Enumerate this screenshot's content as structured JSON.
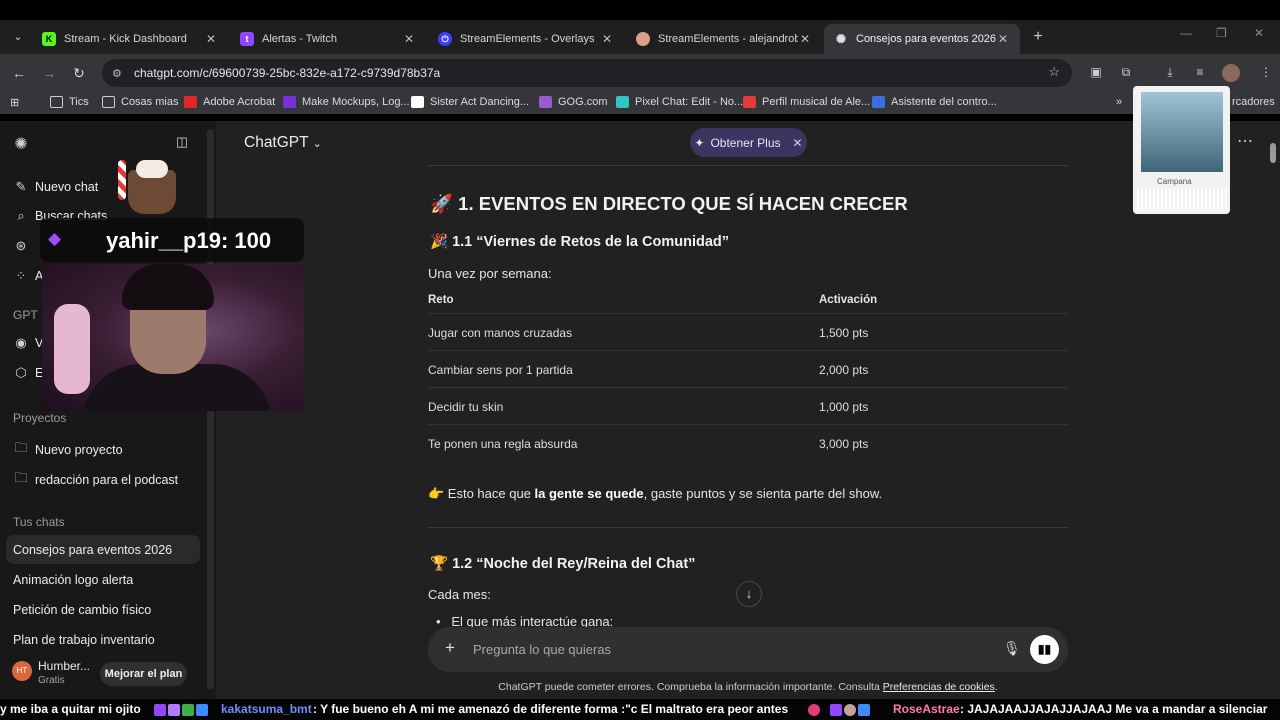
{
  "browser": {
    "tabs": [
      {
        "title": "Stream - Kick Dashboard",
        "favicon": "kick-icon",
        "color": "#53fc18",
        "active": false
      },
      {
        "title": "Alertas - Twitch",
        "favicon": "twitch-icon",
        "color": "#9146ff",
        "active": false
      },
      {
        "title": "StreamElements - Overlays",
        "favicon": "streamelements-icon",
        "color": "#3d3dff",
        "active": false
      },
      {
        "title": "StreamElements - alejandrobmt",
        "favicon": "streamelements-icon",
        "color": "#d9a087",
        "active": false
      },
      {
        "title": "Consejos para eventos 2026",
        "favicon": "openai-icon",
        "color": "#e0e0e0",
        "active": true
      }
    ],
    "url": "chatgpt.com/c/69600739-25bc-832e-a172-c9739d78b37a",
    "bookmarks": [
      {
        "label": "Tics",
        "icon": "folder-icon"
      },
      {
        "label": "Cosas mias",
        "icon": "folder-icon"
      },
      {
        "label": "Adobe Acrobat",
        "icon": "acrobat-icon",
        "color": "#e5252a"
      },
      {
        "label": "Make Mockups, Log...",
        "icon": "placeit-icon",
        "color": "#7b2fd6"
      },
      {
        "label": "Sister Act Dancing...",
        "icon": "doc-icon",
        "color": "#ffffff"
      },
      {
        "label": "GOG.com",
        "icon": "gog-icon",
        "color": "#9a5ad0"
      },
      {
        "label": "Pixel Chat: Edit - No...",
        "icon": "pixelchat-icon",
        "color": "#31c6c6"
      },
      {
        "label": "Perfil musical de Ale...",
        "icon": "music-profile-icon",
        "color": "#e23c3c"
      },
      {
        "label": "Asistente del contro...",
        "icon": "assistant-icon",
        "color": "#3a6de0"
      }
    ],
    "bookmarks_more": "rcadores"
  },
  "sidebar": {
    "primary": [
      {
        "label": "Nuevo chat",
        "icon": "new-chat-icon"
      },
      {
        "label": "Buscar chats",
        "icon": "search-icon"
      },
      {
        "label": "",
        "icon": "images-icon"
      },
      {
        "label": "A",
        "icon": "apps-icon"
      }
    ],
    "gpt_heading": "GPT",
    "gpts": [
      {
        "label": "V",
        "icon": "gpt-icon"
      },
      {
        "label": "E",
        "icon": "cube-icon"
      }
    ],
    "projects_heading": "Proyectos",
    "projects": [
      {
        "label": "Nuevo proyecto",
        "icon": "folder-plus-icon"
      },
      {
        "label": "redacción para el podcast",
        "icon": "folder-icon"
      }
    ],
    "chats_heading": "Tus chats",
    "chats": [
      "Consejos para eventos 2026",
      "Animación logo alerta",
      "Petición de cambio físico",
      "Plan de trabajo inventario"
    ],
    "user": {
      "initials": "HT",
      "name": "Humber...",
      "plan": "Gratis",
      "upgrade": "Mejorar el plan"
    }
  },
  "header": {
    "title": "ChatGPT",
    "plus_label": "Obtener Plus"
  },
  "content": {
    "h1": "🚀 1. EVENTOS EN DIRECTO QUE SÍ HACEN CRECER",
    "section1_title": "🎉 1.1 “Viernes de Retos de la Comunidad”",
    "section1_intro": "Una vez por semana:",
    "table": {
      "headers": [
        "Reto",
        "Activación"
      ],
      "rows": [
        [
          "Jugar con manos cruzadas",
          "1,500 pts"
        ],
        [
          "Cambiar sens por 1 partida",
          "2,000 pts"
        ],
        [
          "Decidir tu skin",
          "1,000 pts"
        ],
        [
          "Te ponen una regla absurda",
          "3,000 pts"
        ]
      ]
    },
    "takeaway_prefix": "👉 Esto hace que ",
    "takeaway_bold": "la gente se quede",
    "takeaway_suffix": ", gaste puntos y se sienta parte del show.",
    "section2_title": "🏆 1.2 “Noche del Rey/Reina del Chat”",
    "section2_intro": "Cada mes:",
    "section2_bullet": "El que más interactúe gana:"
  },
  "composer": {
    "placeholder": "Pregunta lo que quieras"
  },
  "disclaimer": {
    "text": "ChatGPT puede cometer errores. Comprueba la información importante. Consulta ",
    "link": "Preferencias de cookies",
    "end": "."
  },
  "overlay": {
    "points_text": "yahir__p19: 100",
    "music_label": "Campana",
    "ticker": {
      "msg0": "y me iba a quitar mi ojito",
      "user1": "kakatsuma_bmt",
      "msg1": ": Y fue bueno eh  A mi me amenazó de diferente forma :\"c  El maltrato era peor antes",
      "user2": "RoseAstrae",
      "msg2": ": JAJAJAAJJAJAJJAJAAJ  Me va a mandar a silenciar"
    }
  }
}
